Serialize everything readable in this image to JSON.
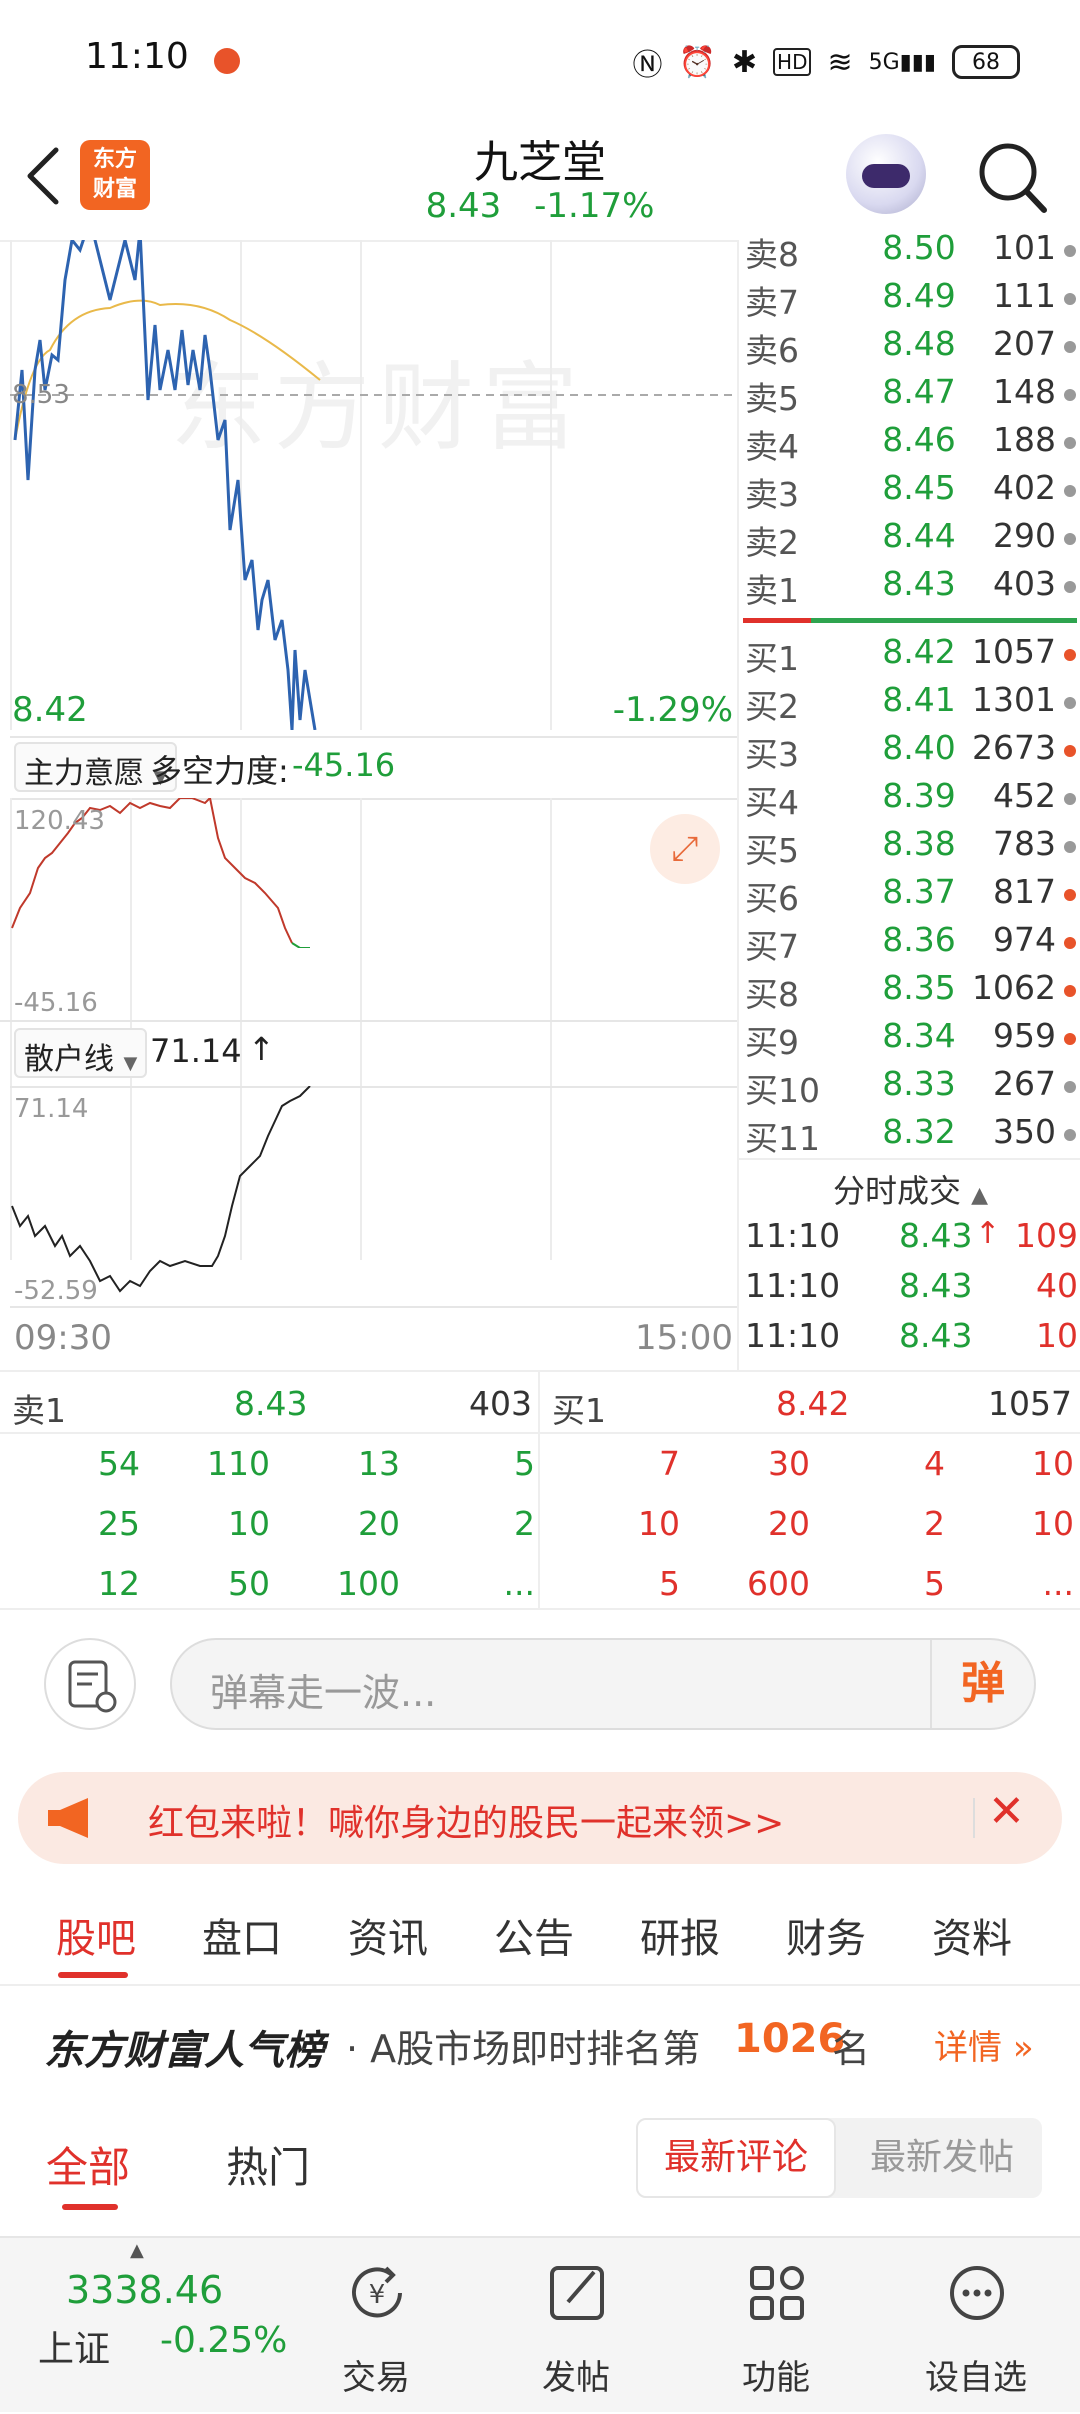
{
  "status_bar": {
    "time": "11:10",
    "battery": "68",
    "signal": "5G"
  },
  "header": {
    "stock_name": "九芝堂",
    "price": "8.43",
    "change_pct": "-1.17%",
    "logo_line1": "东方",
    "logo_line2": "财富"
  },
  "chart": {
    "watermark": "东方财富",
    "ref_price": "8.53",
    "low_price": "8.42",
    "low_pct": "-1.29%",
    "time_start": "09:30",
    "time_end": "15:00",
    "indicator1": {
      "name": "主力意愿",
      "label": "多空力度:",
      "value": "-45.16",
      "max": "120.43",
      "min": "-45.16"
    },
    "indicator2": {
      "name": "散户线",
      "value": "71.14",
      "max": "71.14",
      "min": "-52.59"
    }
  },
  "order_book": {
    "asks": [
      {
        "label": "卖8",
        "price": "8.50",
        "vol": "101"
      },
      {
        "label": "卖7",
        "price": "8.49",
        "vol": "111"
      },
      {
        "label": "卖6",
        "price": "8.48",
        "vol": "207"
      },
      {
        "label": "卖5",
        "price": "8.47",
        "vol": "148"
      },
      {
        "label": "卖4",
        "price": "8.46",
        "vol": "188"
      },
      {
        "label": "卖3",
        "price": "8.45",
        "vol": "402"
      },
      {
        "label": "卖2",
        "price": "8.44",
        "vol": "290"
      },
      {
        "label": "卖1",
        "price": "8.43",
        "vol": "403"
      }
    ],
    "bids": [
      {
        "label": "买1",
        "price": "8.42",
        "vol": "1057",
        "dot": "#e8532a"
      },
      {
        "label": "买2",
        "price": "8.41",
        "vol": "1301",
        "dot": "#999999"
      },
      {
        "label": "买3",
        "price": "8.40",
        "vol": "2673",
        "dot": "#e8532a"
      },
      {
        "label": "买4",
        "price": "8.39",
        "vol": "452",
        "dot": "#999999"
      },
      {
        "label": "买5",
        "price": "8.38",
        "vol": "783",
        "dot": "#999999"
      },
      {
        "label": "买6",
        "price": "8.37",
        "vol": "817",
        "dot": "#e8532a"
      },
      {
        "label": "买7",
        "price": "8.36",
        "vol": "974",
        "dot": "#e8532a"
      },
      {
        "label": "买8",
        "price": "8.35",
        "vol": "1062",
        "dot": "#e8532a"
      },
      {
        "label": "买9",
        "price": "8.34",
        "vol": "959",
        "dot": "#e8532a"
      },
      {
        "label": "买10",
        "price": "8.33",
        "vol": "267",
        "dot": "#999999"
      },
      {
        "label": "买11",
        "price": "8.32",
        "vol": "350",
        "dot": "#999999"
      }
    ],
    "ticks_title": "分时成交",
    "ticks": [
      {
        "time": "11:10",
        "price": "8.43",
        "vol": "109",
        "arrow": "↑"
      },
      {
        "time": "11:10",
        "price": "8.43",
        "vol": "40",
        "arrow": ""
      },
      {
        "time": "11:10",
        "price": "8.43",
        "vol": "10",
        "arrow": ""
      }
    ]
  },
  "queue": {
    "sell_label": "卖1",
    "sell_price": "8.43",
    "sell_vol": "403",
    "buy_label": "买1",
    "buy_price": "8.42",
    "buy_vol": "1057",
    "sell_rows": [
      [
        "54",
        "110",
        "13",
        "5"
      ],
      [
        "25",
        "10",
        "20",
        "2"
      ],
      [
        "12",
        "50",
        "100",
        "..."
      ]
    ],
    "buy_rows": [
      [
        "7",
        "30",
        "4",
        "10"
      ],
      [
        "10",
        "20",
        "2",
        "10"
      ],
      [
        "5",
        "600",
        "5",
        "..."
      ]
    ]
  },
  "comment": {
    "placeholder": "弹幕走一波...",
    "danmu_btn": "弹"
  },
  "banner": {
    "text": "红包来啦！喊你身边的股民一起来领>>"
  },
  "tabs": [
    "股吧",
    "盘口",
    "资讯",
    "公告",
    "研报",
    "财务",
    "资料"
  ],
  "rank": {
    "brand": "东方财富人气榜",
    "text_prefix": "· A股市场即时排名第",
    "rank_num": "1026",
    "text_suffix": "名",
    "detail": "详情"
  },
  "subtabs": {
    "all": "全部",
    "hot": "热门",
    "latest_comment": "最新评论",
    "latest_post": "最新发帖"
  },
  "bottom_nav": {
    "index_value": "3338.46",
    "index_name": "上证",
    "index_change": "-0.25%",
    "trade": "交易",
    "post": "发帖",
    "function": "功能",
    "watchlist": "设自选"
  }
}
